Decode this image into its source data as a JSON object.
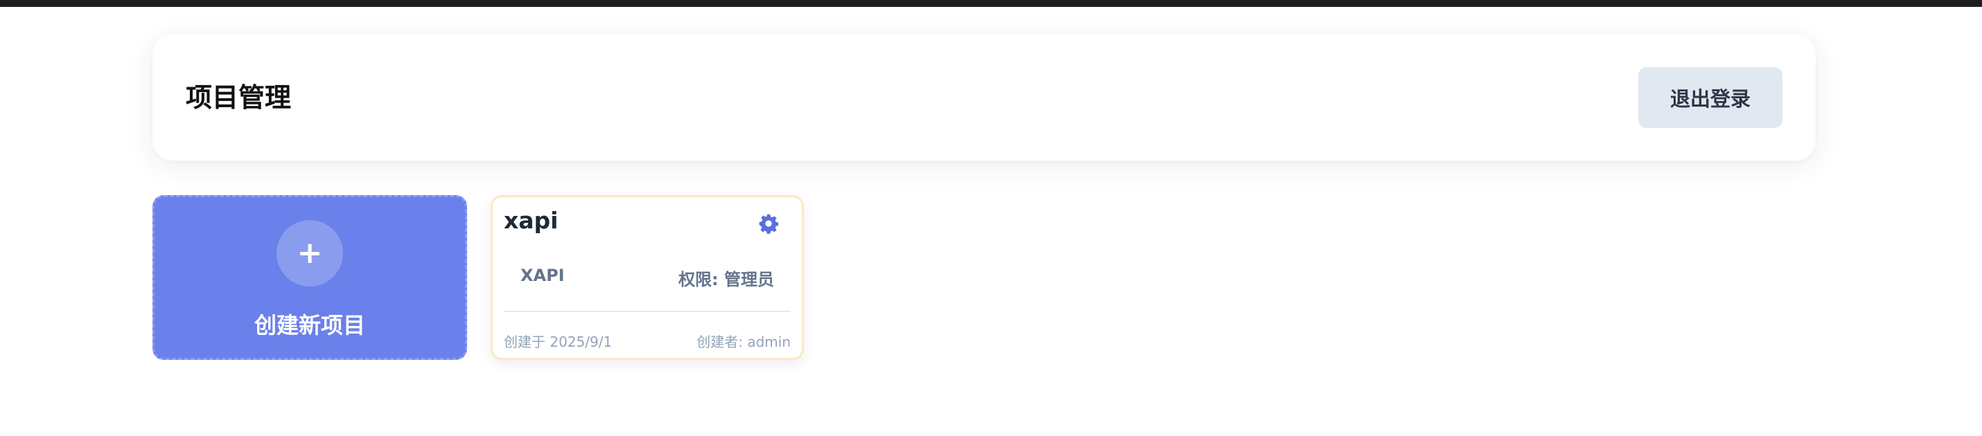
{
  "header": {
    "title": "项目管理",
    "logout_label": "退出登录"
  },
  "create_card": {
    "plus": "+",
    "label": "创建新项目"
  },
  "projects": [
    {
      "name": "xapi",
      "code": "XAPI",
      "permission": "权限: 管理员",
      "created": "创建于 2025/9/1",
      "creator": "创建者: admin",
      "settings_icon": "gear-icon"
    }
  ],
  "colors": {
    "accent": "#6a80ea",
    "settings_icon": "#5a6fd8",
    "logout_bg": "#e2e8f0",
    "card_border": "#fde8c4"
  }
}
